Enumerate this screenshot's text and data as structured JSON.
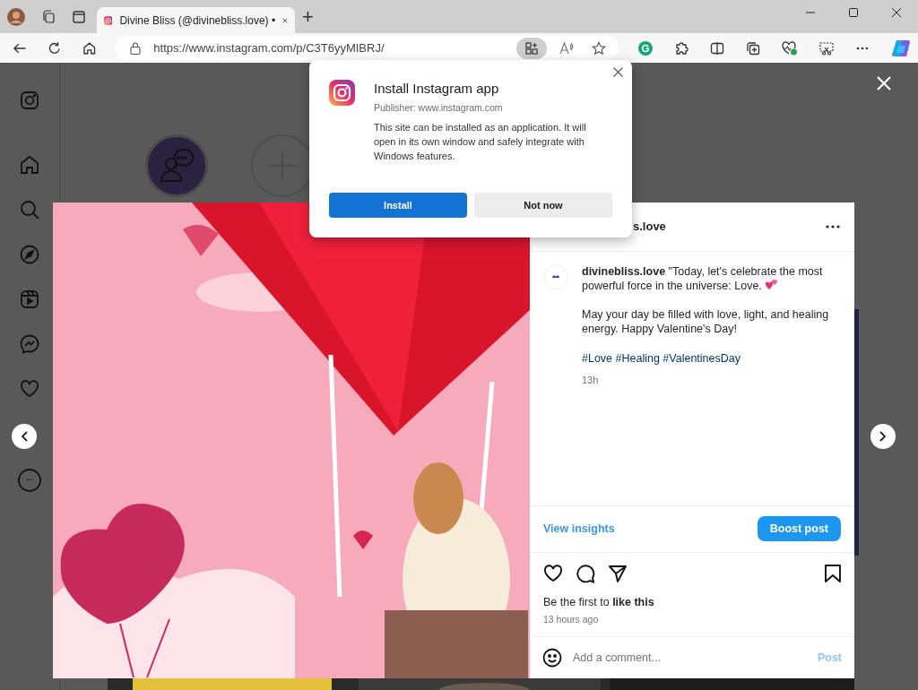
{
  "browser": {
    "tab": {
      "title": "Divine Bliss (@divinebliss.love) •",
      "selected": true
    },
    "new_tab": "+",
    "url": "https://www.instagram.com/p/C3T6yyMIBRJ/"
  },
  "popup": {
    "title": "Install Instagram app",
    "publisher": "Publisher: www.instagram.com",
    "body": "This site can be installed as an application. It will open in its own window and safely integrate with Windows features.",
    "buttons": [
      {
        "label": "Install",
        "primary": true
      },
      {
        "label": "Not now",
        "primary": false
      }
    ]
  },
  "post": {
    "header_name": "s.love",
    "caption": [
      "**divinebliss.love** \"Today, let's celebrate the most powerful force in the universe: Love.",
      "May your day be filled with love, light, and healing energy. Happy Valentine's Day!"
    ],
    "hashtags": "#Love #Healing #ValentinesDay",
    "age": "13h",
    "view_insights": "View insights",
    "boost": "Boost post",
    "likes": "Be the first to **like this**",
    "time": "13 hours ago",
    "comment_placeholder": "Add a comment...",
    "post_button": {
      "label": "Post",
      "disabled": true
    }
  }
}
